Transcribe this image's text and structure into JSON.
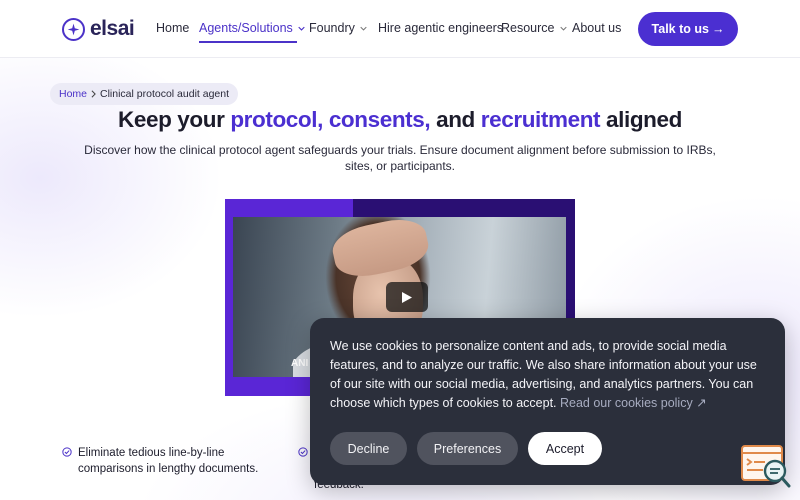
{
  "brand": {
    "name": "elsai",
    "accent": "#4b2fd1"
  },
  "nav": {
    "items": [
      {
        "label": "Home",
        "has_dropdown": false,
        "active": false
      },
      {
        "label": "Agents/Solutions",
        "has_dropdown": true,
        "active": true
      },
      {
        "label": "Foundry",
        "has_dropdown": true,
        "active": false
      },
      {
        "label": "Hire agentic engineers",
        "has_dropdown": false,
        "active": false
      },
      {
        "label": "Resource",
        "has_dropdown": true,
        "active": false
      },
      {
        "label": "About us",
        "has_dropdown": false,
        "active": false
      }
    ],
    "cta_label": "Talk to us"
  },
  "breadcrumb": {
    "home": "Home",
    "current": "Clinical protocol audit agent"
  },
  "hero": {
    "title_parts": [
      "Keep your ",
      "protocol,",
      " ",
      "consents,",
      " and ",
      "recruitment",
      " aligned"
    ],
    "subtitle": "Discover how the clinical protocol agent safeguards your trials. Ensure document alignment before submission to IRBs, sites, or participants."
  },
  "video": {
    "caption": "ANI",
    "play_icon": "play-icon"
  },
  "bullets": [
    {
      "text": "Eliminate tedious line-by-line comparisons in lengthy documents."
    },
    {
      "text": "feedback."
    }
  ],
  "cookie_banner": {
    "text": "We use cookies to personalize content and ads, to provide social media features, and to analyze our traffic. We also share information about your use of our site with our social media, advertising, and analytics partners. You can choose which types of cookies to accept.",
    "link_label": "Read our cookies policy ↗",
    "decline_label": "Decline",
    "preferences_label": "Preferences",
    "accept_label": "Accept"
  }
}
